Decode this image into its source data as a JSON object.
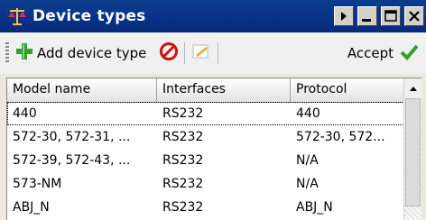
{
  "window": {
    "title": "Device types",
    "title_icon": "scale-icon",
    "buttons": [
      "pin-button",
      "minimize-button",
      "maximize-button",
      "close-button"
    ]
  },
  "toolbar": {
    "add_label": "Add device type",
    "add_icon": "green-plus-icon",
    "delete_icon": "no-entry-icon",
    "edit_icon": "edit-note-icon",
    "accept_label": "Accept",
    "accept_icon": "green-check-icon"
  },
  "table": {
    "columns": [
      "Model name",
      "Interfaces",
      "Protocol"
    ],
    "rows": [
      [
        "440",
        "RS232",
        "440"
      ],
      [
        "572-30, 572-31, ...",
        "RS232",
        "572-30, 572..."
      ],
      [
        "572-39, 572-43, ...",
        "RS232",
        "N/A"
      ],
      [
        "573-NM",
        "RS232",
        "N/A"
      ],
      [
        "ABJ_N",
        "RS232",
        "ABJ_N"
      ]
    ]
  },
  "colors": {
    "titlebar": "#0b3d8c",
    "accent_green": "#2ea12e",
    "delete_red": "#d01010"
  }
}
